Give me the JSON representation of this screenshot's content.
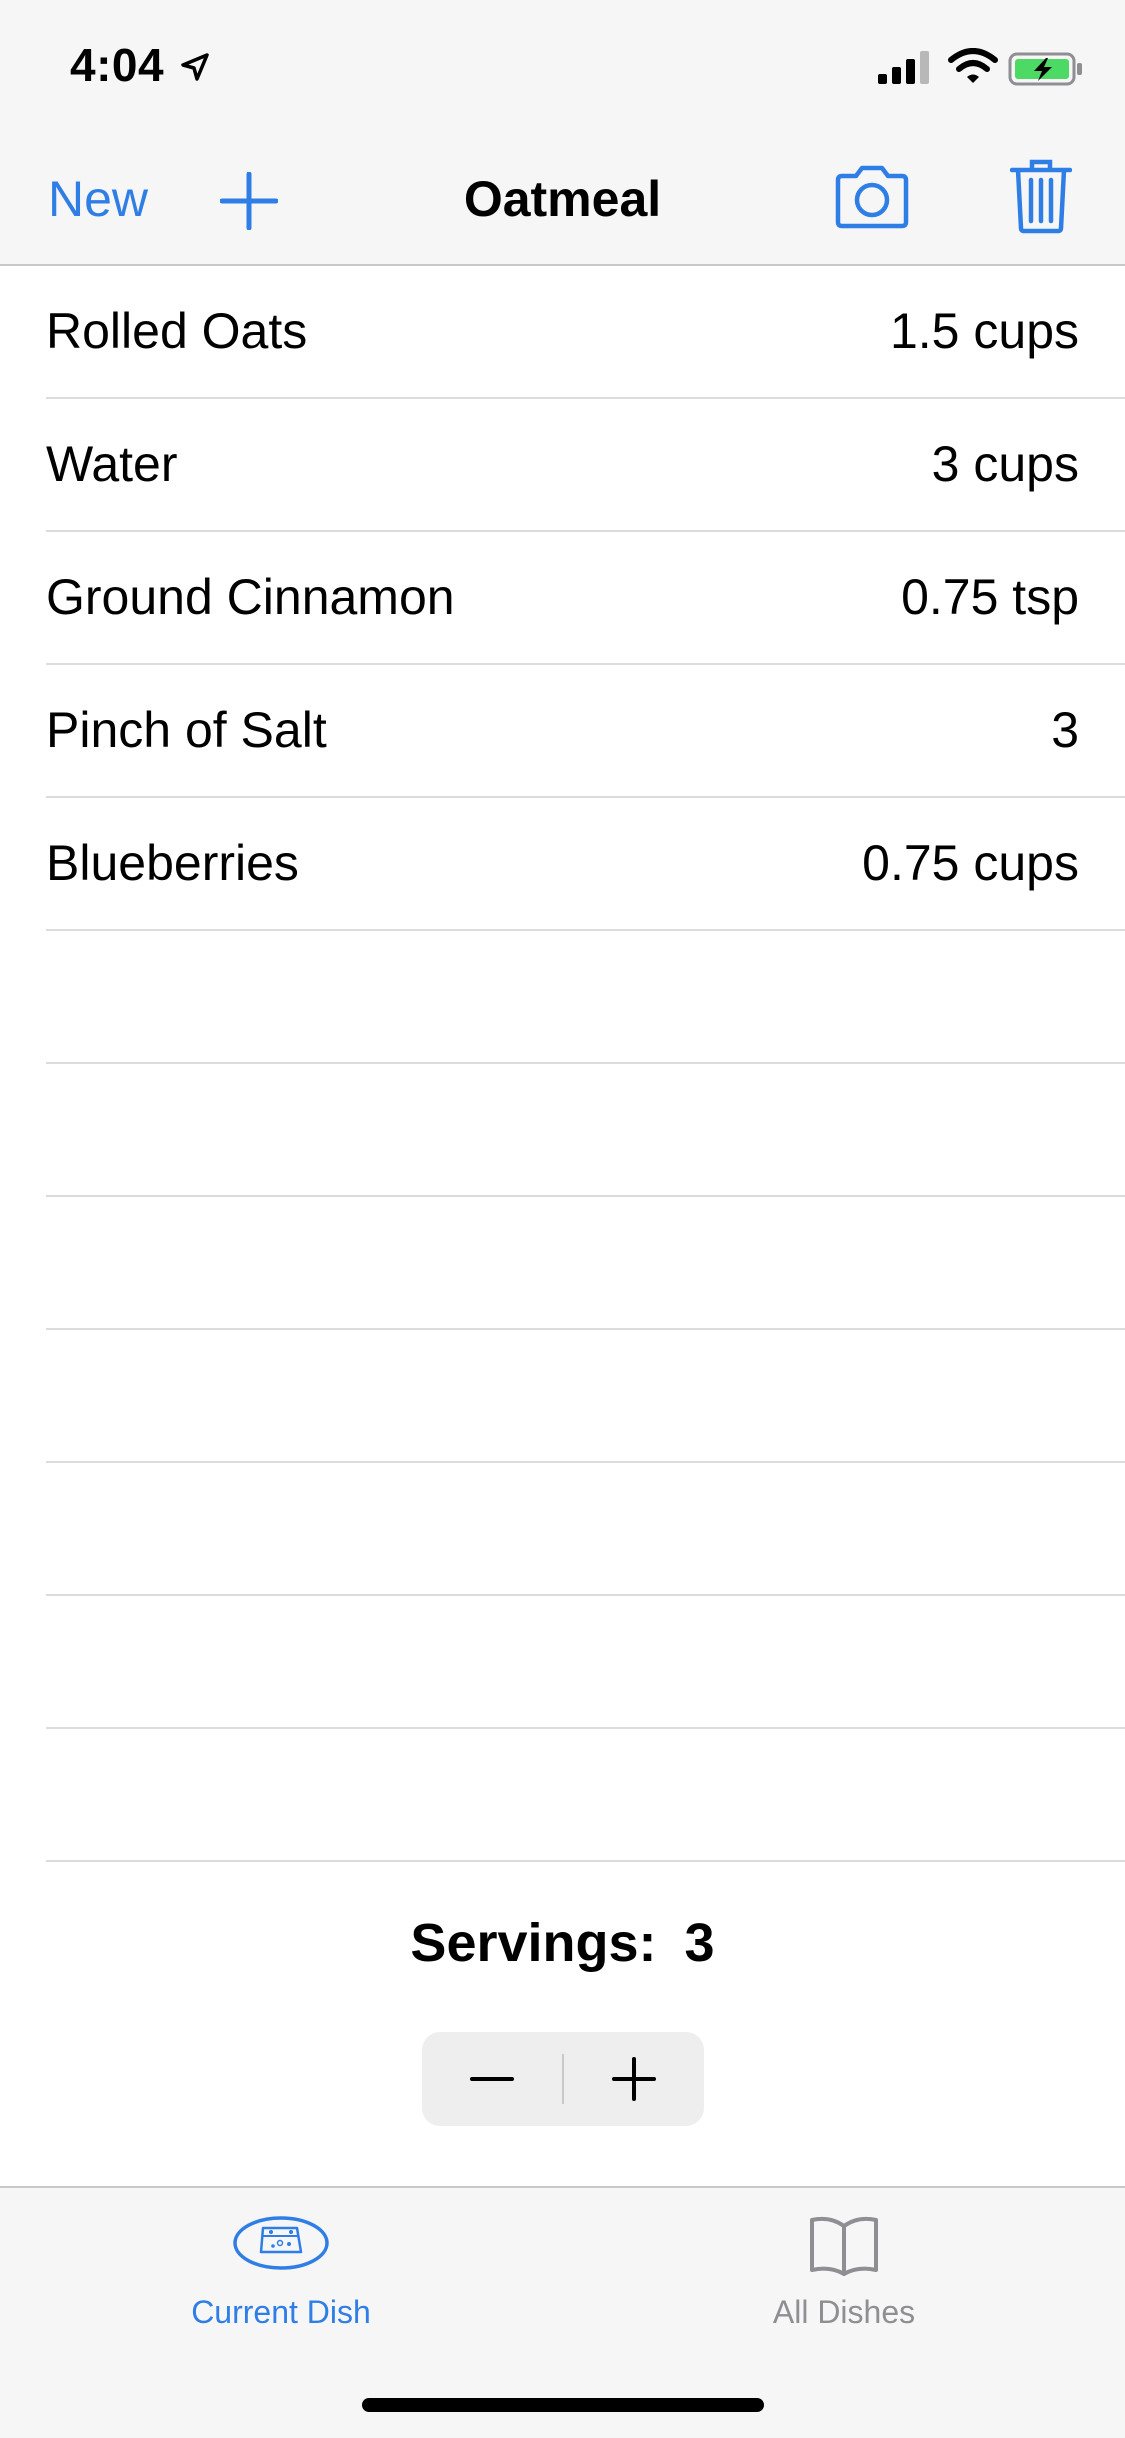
{
  "status": {
    "time": "4:04"
  },
  "nav": {
    "new_label": "New",
    "title": "Oatmeal"
  },
  "ingredients": [
    {
      "name": "Rolled Oats",
      "qty": "1.5 cups"
    },
    {
      "name": "Water",
      "qty": "3 cups"
    },
    {
      "name": "Ground Cinnamon",
      "qty": "0.75 tsp"
    },
    {
      "name": "Pinch of Salt",
      "qty": "3"
    },
    {
      "name": "Blueberries",
      "qty": "0.75 cups"
    }
  ],
  "servings": {
    "label": "Servings:",
    "value": "3"
  },
  "tabs": [
    {
      "label": "Current Dish",
      "icon": "dish-icon",
      "selected": true
    },
    {
      "label": "All Dishes",
      "icon": "book-icon",
      "selected": false
    }
  ],
  "colors": {
    "accent": "#2f7ee6",
    "inactive": "#8e8e93"
  }
}
